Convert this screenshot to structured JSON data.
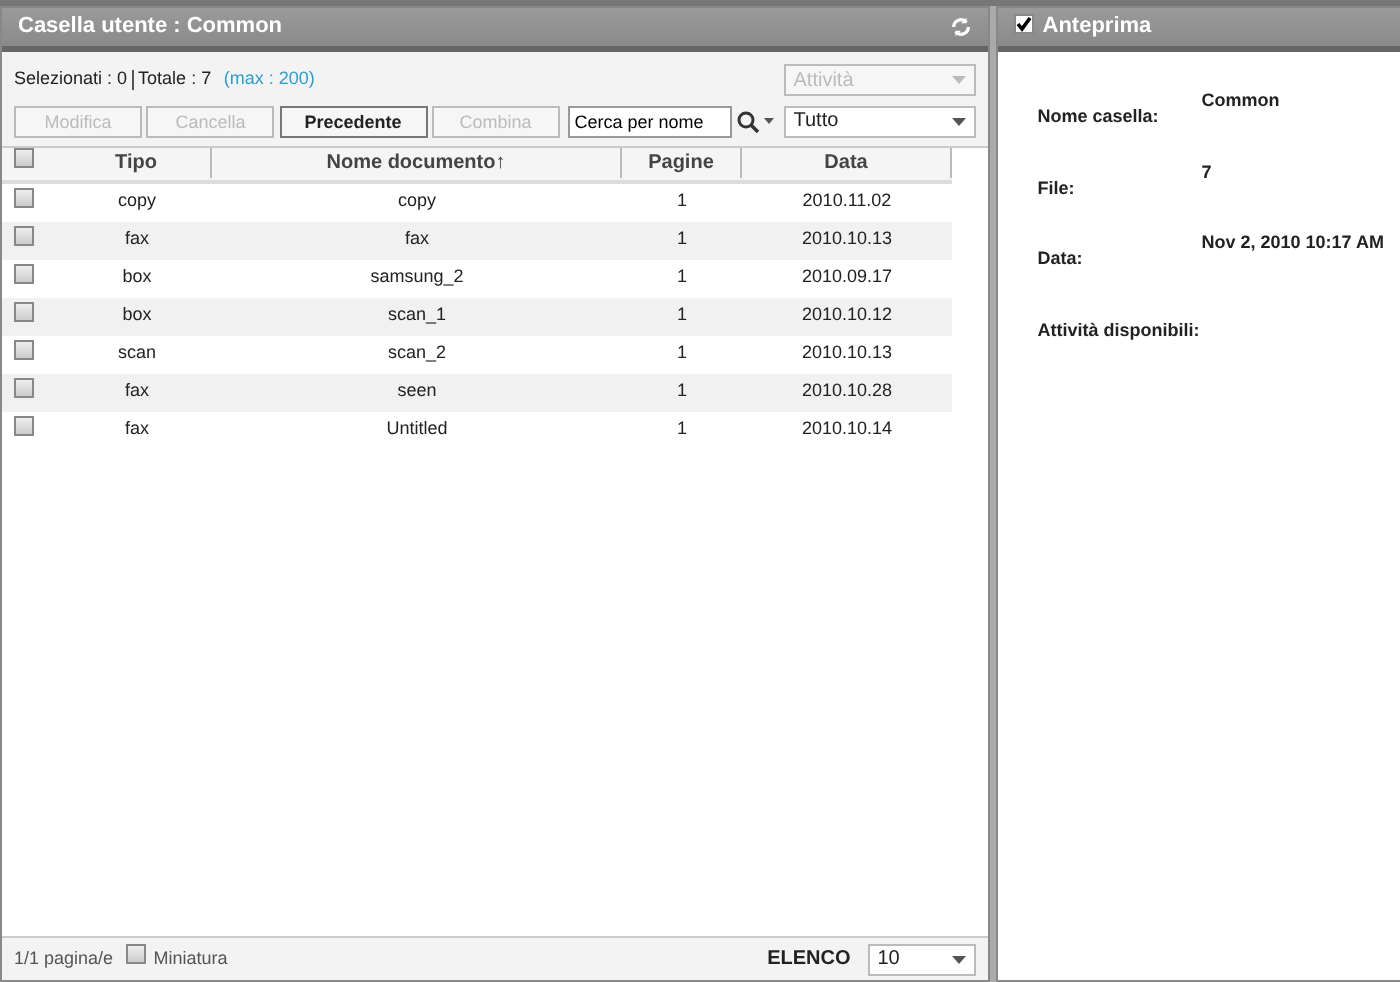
{
  "left_panel": {
    "title": "Casella utente : Common"
  },
  "summary": {
    "selected": "Selezionati : 0",
    "total": "Totale : 7",
    "max": "(max : 200)"
  },
  "activity_dropdown": {
    "value": "Attività",
    "disabled": true
  },
  "buttons": [
    {
      "label": "Modifica",
      "disabled": true
    },
    {
      "label": "Cancella",
      "disabled": true
    },
    {
      "label": "Precedente",
      "disabled": false
    },
    {
      "label": "Combina",
      "disabled": true
    }
  ],
  "search": {
    "value": "Cerca per nome"
  },
  "filter": {
    "value": "Tutto"
  },
  "table": {
    "select_all_checked": false,
    "columns": [
      "Tipo",
      "Nome documento↑",
      "Pagine",
      "Data"
    ],
    "rows": [
      {
        "checked": false,
        "cells": [
          "copy",
          "copy",
          "1",
          "2010.11.02"
        ]
      },
      {
        "checked": false,
        "cells": [
          "fax",
          "fax",
          "1",
          "2010.10.13"
        ]
      },
      {
        "checked": false,
        "cells": [
          "box",
          "samsung_2",
          "1",
          "2010.09.17"
        ]
      },
      {
        "checked": false,
        "cells": [
          "box",
          "scan_1",
          "1",
          "2010.10.12"
        ]
      },
      {
        "checked": false,
        "cells": [
          "scan",
          "scan_2",
          "1",
          "2010.10.13"
        ]
      },
      {
        "checked": false,
        "cells": [
          "fax",
          "seen",
          "1",
          "2010.10.28"
        ]
      },
      {
        "checked": false,
        "cells": [
          "fax",
          "Untitled",
          "1",
          "2010.10.14"
        ]
      }
    ]
  },
  "footer": {
    "pages": "1/1 pagina/e",
    "thumbnail": {
      "label": "Miniatura",
      "checked": false
    },
    "list_label": "ELENCO",
    "per_page": "10"
  },
  "preview": {
    "checked": true,
    "title": "Anteprima",
    "fields": [
      {
        "label": "Nome casella:",
        "value": "Common"
      },
      {
        "label": "File:",
        "value": "7"
      },
      {
        "label": "Data:",
        "value": "Nov 2, 2010 10:17 AM"
      },
      {
        "label": "Attività disponibili:"
      }
    ]
  }
}
